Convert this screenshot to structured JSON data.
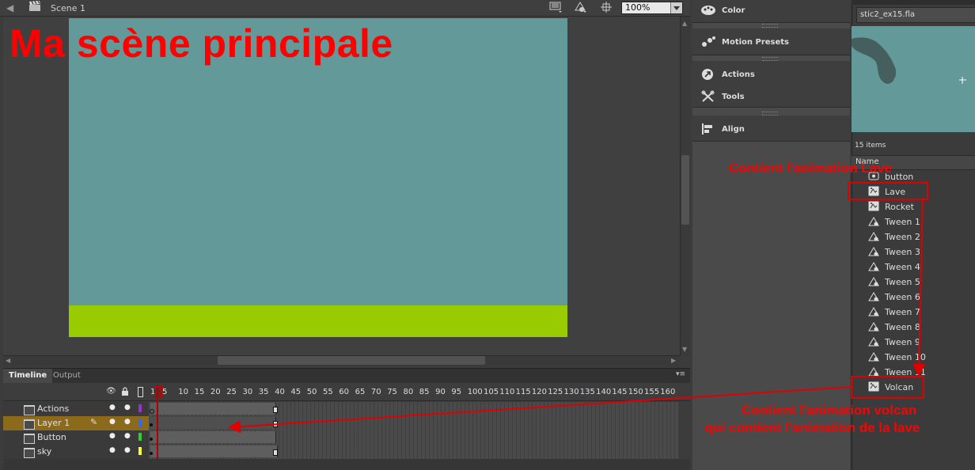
{
  "scene_bar": {
    "scene_name": "Scene 1",
    "zoom": "100%"
  },
  "stage": {
    "title": "Ma scène principale",
    "stage_color": "#639998",
    "ground_color": "#99cc00"
  },
  "timeline": {
    "tabs": [
      "Timeline",
      "Output"
    ],
    "frame_numbers": [
      "1",
      "5",
      "10",
      "15",
      "20",
      "25",
      "30",
      "35",
      "40",
      "45",
      "50",
      "55",
      "60",
      "65",
      "70",
      "75",
      "80",
      "85",
      "90",
      "95",
      "100",
      "105",
      "110",
      "115",
      "120",
      "125",
      "130",
      "135",
      "140",
      "145",
      "150",
      "155",
      "160"
    ],
    "layers": [
      {
        "name": "Actions",
        "color": "#9933cc"
      },
      {
        "name": "Layer 1",
        "color": "#3366ff"
      },
      {
        "name": "Button",
        "color": "#33cc33"
      },
      {
        "name": "sky",
        "color": "#ffff33"
      }
    ],
    "playhead_frame": 1
  },
  "panels": [
    {
      "label": "Color",
      "icon": "palette-icon"
    },
    {
      "label": "Motion Presets",
      "icon": "motion-presets-icon"
    },
    {
      "label": "Actions",
      "icon": "actions-icon"
    },
    {
      "label": "Tools",
      "icon": "tools-icon"
    },
    {
      "label": "Align",
      "icon": "align-icon"
    }
  ],
  "library": {
    "document": "stic2_ex15.fla",
    "count": "15 items",
    "column": "Name",
    "items": [
      "button",
      "Lave",
      "Rocket",
      "Tween 1",
      "Tween 2",
      "Tween 3",
      "Tween 4",
      "Tween 5",
      "Tween 6",
      "Tween 7",
      "Tween 8",
      "Tween 9",
      "Tween 10",
      "Tween 11",
      "Volcan"
    ]
  },
  "annotations": {
    "lave_note": "Contient l'animation Lave",
    "volcan_note_1": "Contient l'animation volcan",
    "volcan_note_2": "qui contient l'animation de la lave",
    "color": "#ff0000"
  }
}
